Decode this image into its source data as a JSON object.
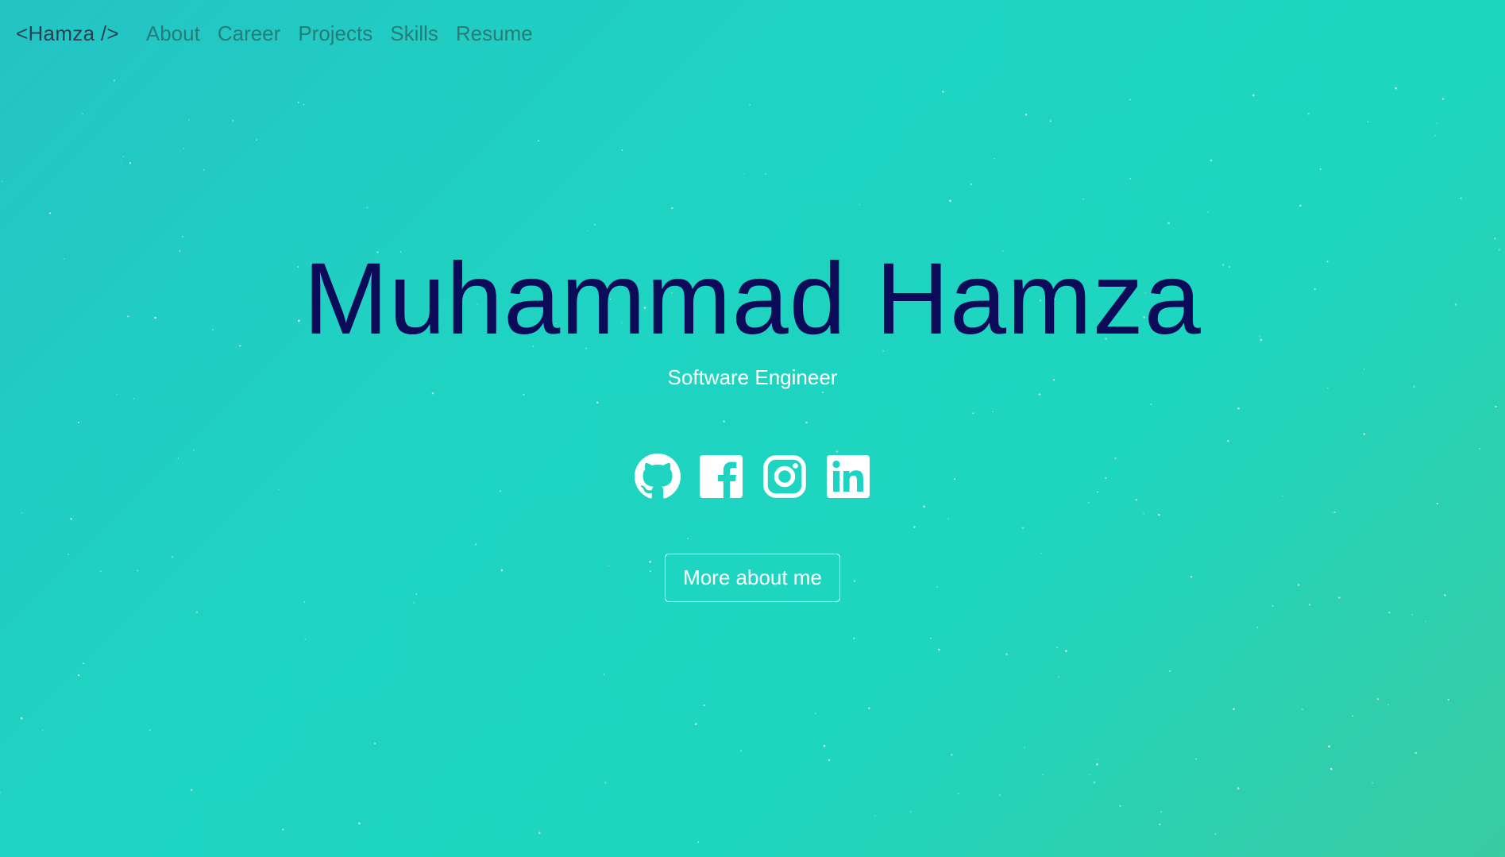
{
  "navbar": {
    "brand": "<Hamza />",
    "links": [
      {
        "label": "About"
      },
      {
        "label": "Career"
      },
      {
        "label": "Projects"
      },
      {
        "label": "Skills"
      },
      {
        "label": "Resume"
      }
    ]
  },
  "hero": {
    "name": "Muhammad Hamza",
    "subtitle": "Software Engineer",
    "social": [
      {
        "icon": "github-icon"
      },
      {
        "icon": "facebook-icon"
      },
      {
        "icon": "instagram-icon"
      },
      {
        "icon": "linkedin-icon"
      }
    ],
    "cta_label": "More about me"
  },
  "colors": {
    "background_start": "#24c3c4",
    "background_end": "#39cba2",
    "title": "#0c0b5a",
    "nav_link": "#277c7a",
    "brand": "#2c3e50",
    "accent_white": "#ffffff"
  }
}
